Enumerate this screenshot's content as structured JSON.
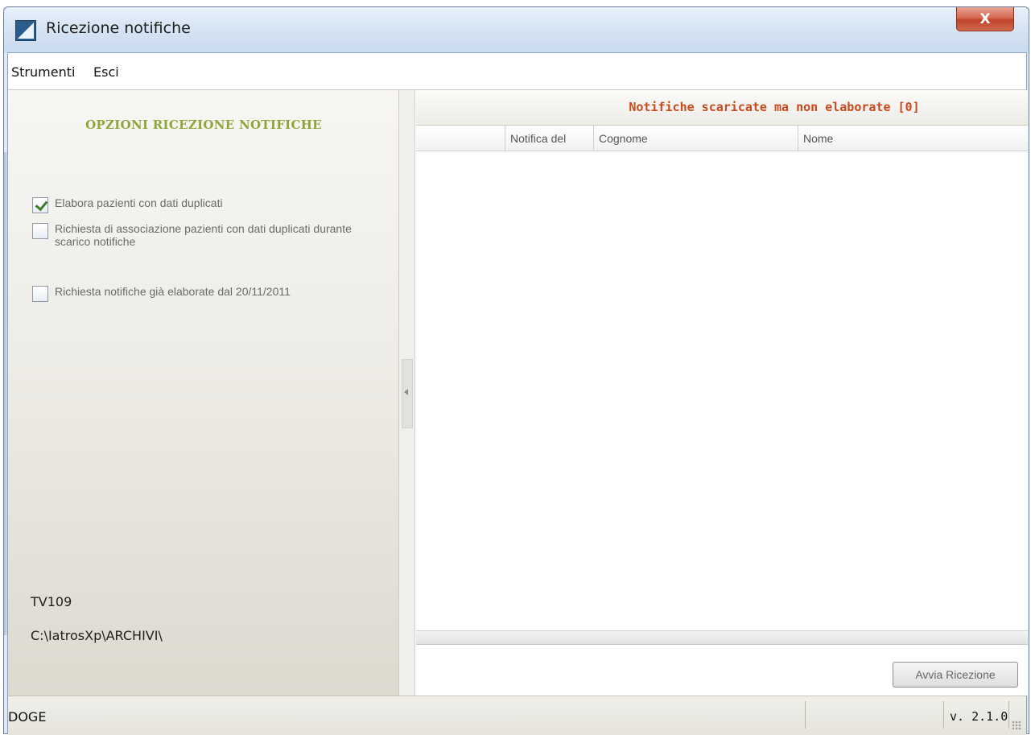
{
  "window": {
    "title": "Ricezione notifiche",
    "close_label": "X"
  },
  "menu": {
    "items": [
      "Strumenti",
      "Esci"
    ]
  },
  "options": {
    "heading": "OPZIONI RICEZIONE NOTIFICHE",
    "checkboxes": [
      {
        "label": "Elabora pazienti con dati duplicati",
        "checked": true
      },
      {
        "label": "Richiesta di associazione pazienti con dati duplicati durante scarico notifiche",
        "checked": false
      },
      {
        "label": "Richiesta notifiche già elaborate dal 20/11/2011",
        "checked": false
      }
    ],
    "station_code": "TV109",
    "archive_path": "C:\\IatrosXp\\ARCHIVI\\"
  },
  "grid": {
    "caption": "Notifiche scaricate ma non elaborate [0]",
    "columns": [
      "",
      "Notifica del",
      "Cognome",
      "Nome"
    ],
    "rows": []
  },
  "actions": {
    "start_label": "Avvia Ricezione"
  },
  "status": {
    "text": "DOGE",
    "version": "v. 2.1.0"
  }
}
